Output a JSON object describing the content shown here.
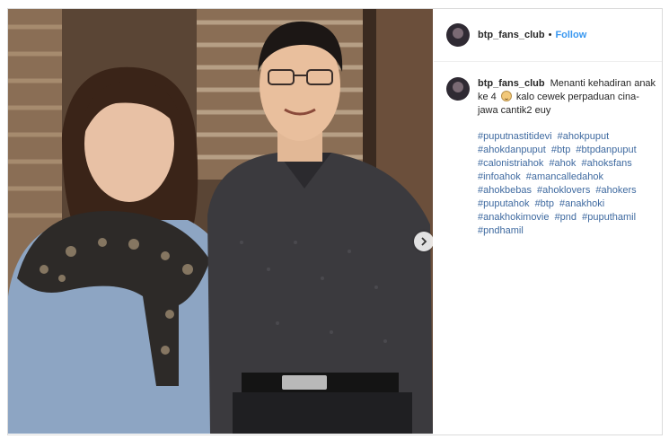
{
  "header": {
    "username": "btp_fans_club",
    "separator": "•",
    "follow_label": "Follow"
  },
  "comment": {
    "username": "btp_fans_club",
    "caption_part1": "Menanti kehadiran anak ke 4",
    "emoji": "smiling-face-emoji",
    "caption_part2": "kalo cewek perpaduan cina-jawa cantik2 euy"
  },
  "hashtags": [
    "#puputnastitidevi",
    "#ahokpuput",
    "#ahokdanpuput",
    "#btp",
    "#btpdanpuput",
    "#calonistriahok",
    "#ahok",
    "#ahoksfans",
    "#infoahok",
    "#amancalledahok",
    "#ahokbebas",
    "#ahoklovers",
    "#ahokers",
    "#puputahok",
    "#btp",
    "#anakhoki",
    "#anakhokimovie",
    "#pnd",
    "#puputhamil",
    "#pndhamil"
  ],
  "colors": {
    "link": "#3f6aa0",
    "follow": "#3897f0",
    "border": "#dbdbdb"
  },
  "icons": {
    "next": "chevron-right-icon"
  }
}
